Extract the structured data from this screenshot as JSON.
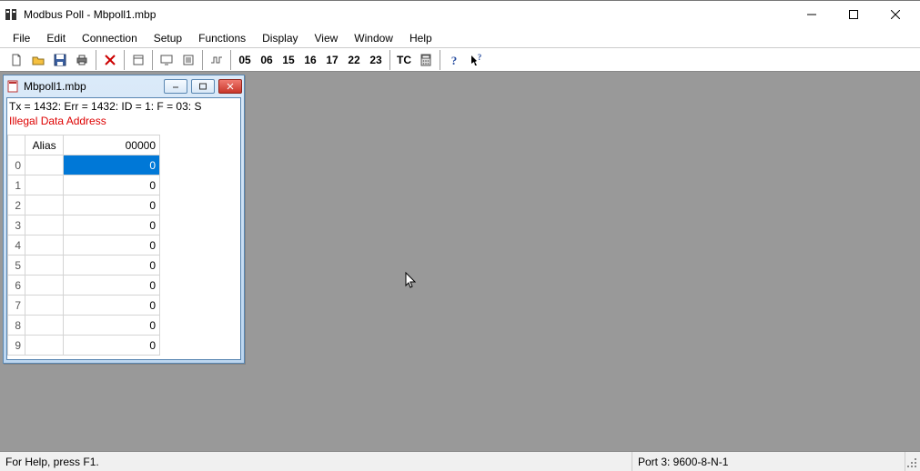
{
  "app": {
    "title": "Modbus Poll - Mbpoll1.mbp"
  },
  "menu": {
    "items": [
      "File",
      "Edit",
      "Connection",
      "Setup",
      "Functions",
      "Display",
      "View",
      "Window",
      "Help"
    ]
  },
  "toolbar": {
    "text_buttons": [
      "05",
      "06",
      "15",
      "16",
      "17",
      "22",
      "23"
    ],
    "tc_label": "TC"
  },
  "child": {
    "title": "Mbpoll1.mbp",
    "status_line1": "Tx = 1432: Err = 1432: ID = 1: F = 03: S",
    "status_line2": "Illegal Data Address"
  },
  "grid": {
    "header_alias": "Alias",
    "header_value": "00000",
    "rows": [
      {
        "idx": "0",
        "alias": "",
        "val": "0",
        "selected": true
      },
      {
        "idx": "1",
        "alias": "",
        "val": "0",
        "selected": false
      },
      {
        "idx": "2",
        "alias": "",
        "val": "0",
        "selected": false
      },
      {
        "idx": "3",
        "alias": "",
        "val": "0",
        "selected": false
      },
      {
        "idx": "4",
        "alias": "",
        "val": "0",
        "selected": false
      },
      {
        "idx": "5",
        "alias": "",
        "val": "0",
        "selected": false
      },
      {
        "idx": "6",
        "alias": "",
        "val": "0",
        "selected": false
      },
      {
        "idx": "7",
        "alias": "",
        "val": "0",
        "selected": false
      },
      {
        "idx": "8",
        "alias": "",
        "val": "0",
        "selected": false
      },
      {
        "idx": "9",
        "alias": "",
        "val": "0",
        "selected": false
      }
    ]
  },
  "status": {
    "help": "For Help, press F1.",
    "port": "Port 3: 9600-8-N-1"
  }
}
